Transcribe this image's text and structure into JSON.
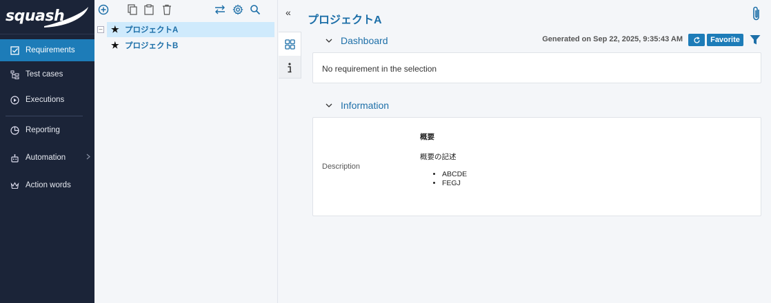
{
  "app": {
    "logo_text": "squash"
  },
  "nav": {
    "items": [
      {
        "label": "Requirements",
        "icon": "checkbox-icon"
      },
      {
        "label": "Test cases",
        "icon": "tree-icon"
      },
      {
        "label": "Executions",
        "icon": "play-circle-icon"
      },
      {
        "label": "Reporting",
        "icon": "pie-chart-icon"
      },
      {
        "label": "Automation",
        "icon": "robot-icon"
      },
      {
        "label": "Action words",
        "icon": "crown-icon"
      }
    ]
  },
  "tree": {
    "items": [
      {
        "label": "プロジェクトA"
      },
      {
        "label": "プロジェクトB"
      }
    ]
  },
  "main": {
    "title": "プロジェクトA",
    "dashboard": {
      "heading": "Dashboard",
      "generated": "Generated on Sep 22, 2025, 9:35:43 AM",
      "favorite_label": "Favorite",
      "message": "No requirement in the selection"
    },
    "information": {
      "heading": "Information",
      "description_label": "Description",
      "content_heading": "概要",
      "content_text": "概要の記述",
      "bullets": [
        "ABCDE",
        "FEGJ"
      ]
    }
  },
  "colors": {
    "nav_bg": "#1b2438",
    "accent": "#1d7cb8",
    "link": "#1d6fa8",
    "selected_row": "#cfeafc"
  }
}
